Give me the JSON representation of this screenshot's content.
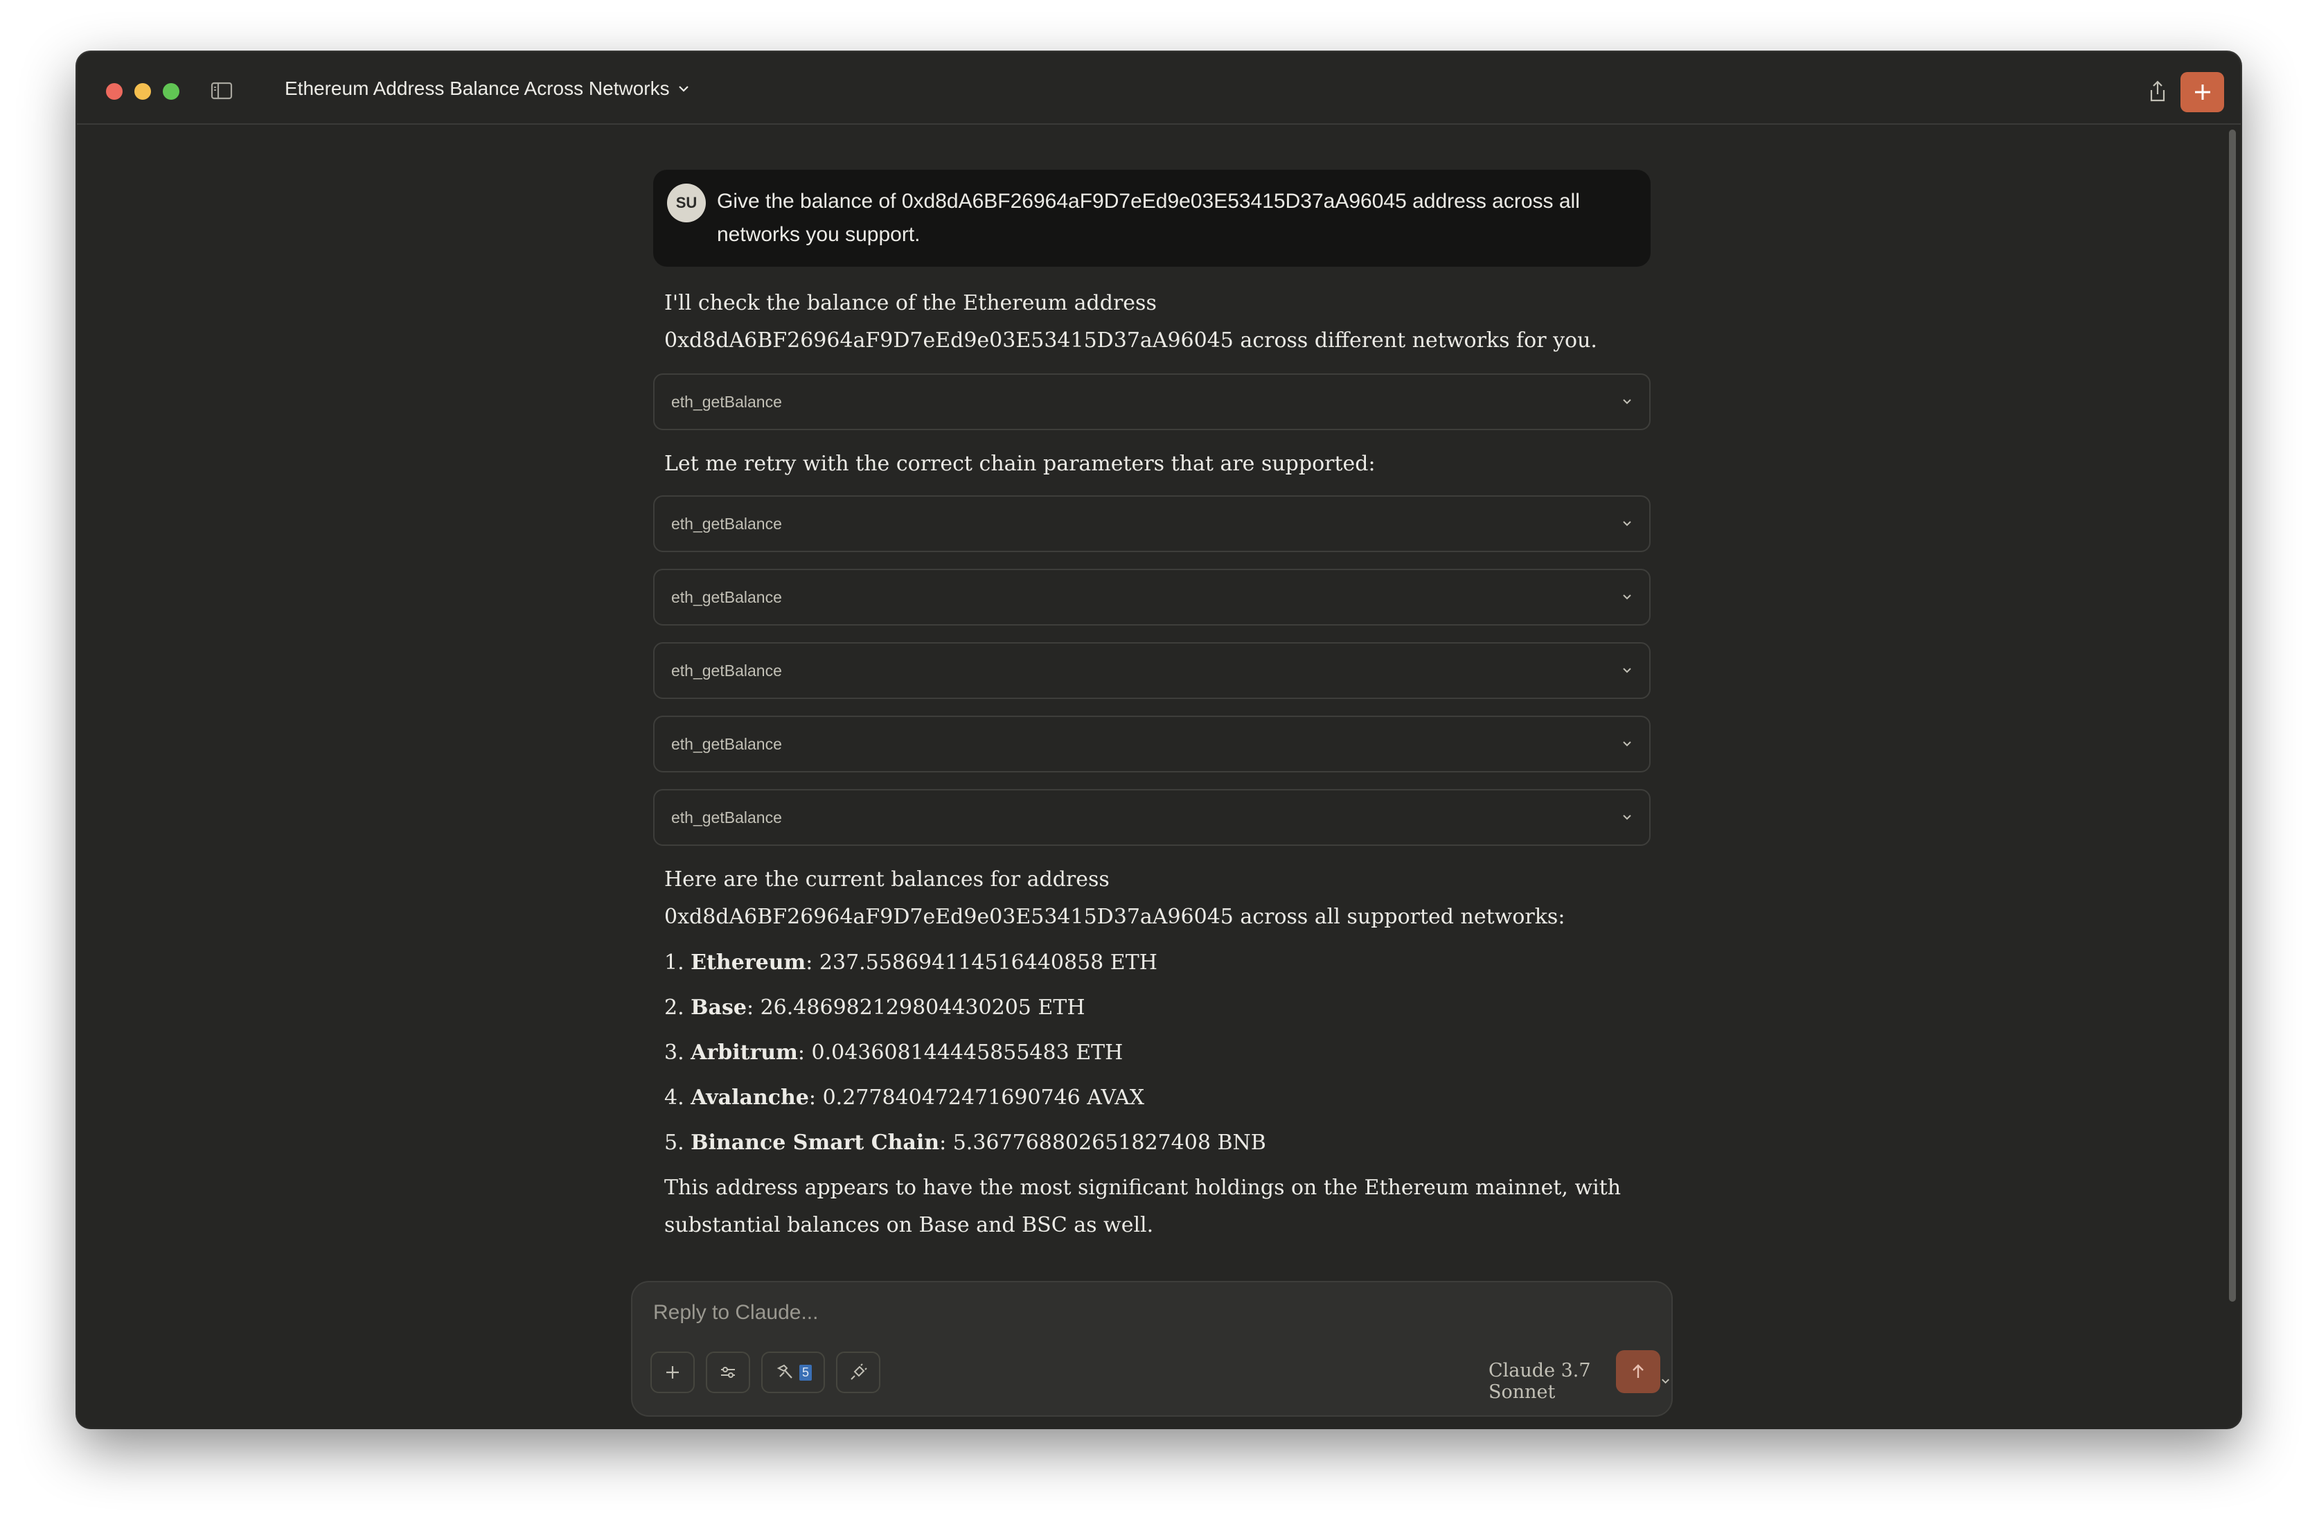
{
  "window": {
    "title": "Ethereum Address Balance Across Networks"
  },
  "colors": {
    "traffic_close": "#ed6a5e",
    "traffic_minimize": "#f5bf4f",
    "traffic_maximize": "#61c554",
    "accent": "#c96442",
    "send_button": "#8a4a35"
  },
  "icons": {
    "sidebar_toggle": "sidebar-icon",
    "title_dropdown": "chevron-down-icon",
    "share": "share-icon",
    "new_chat": "plus-icon"
  },
  "conversation": {
    "user_message": {
      "avatar_initials": "SU",
      "text": "Give the balance of 0xd8dA6BF26964aF9D7eEd9e03E53415D37aA96045 address across all networks you support."
    },
    "intro_line_1": "I'll check the balance of the Ethereum address",
    "intro_line_2": "0xd8dA6BF26964aF9D7eEd9e03E53415D37aA96045 across different networks for you.",
    "tool_call_first": "eth_getBalance",
    "retry_text": "Let me retry with the correct chain parameters that are supported:",
    "tool_calls": [
      "eth_getBalance",
      "eth_getBalance",
      "eth_getBalance",
      "eth_getBalance",
      "eth_getBalance"
    ],
    "summary_line_1": "Here are the current balances for address",
    "summary_line_2": "0xd8dA6BF26964aF9D7eEd9e03E53415D37aA96045 across all supported networks:",
    "balances": [
      {
        "index": "1.",
        "network": "Ethereum",
        "value": ": 237.558694114516440858 ETH"
      },
      {
        "index": "2.",
        "network": "Base",
        "value": ": 26.486982129804430205 ETH"
      },
      {
        "index": "3.",
        "network": "Arbitrum",
        "value": ": 0.043608144445855483 ETH"
      },
      {
        "index": "4.",
        "network": "Avalanche",
        "value": ": 0.277840472471690746 AVAX"
      },
      {
        "index": "5.",
        "network": "Binance Smart Chain",
        "value": ": 5.367768802651827408 BNB"
      }
    ],
    "closing_line_1": "This address appears to have the most significant holdings on the Ethereum mainnet, with",
    "closing_line_2": "substantial balances on Base and BSC as well."
  },
  "composer": {
    "placeholder": "Reply to Claude...",
    "tools_count": "5",
    "model": "Claude 3.7 Sonnet"
  }
}
